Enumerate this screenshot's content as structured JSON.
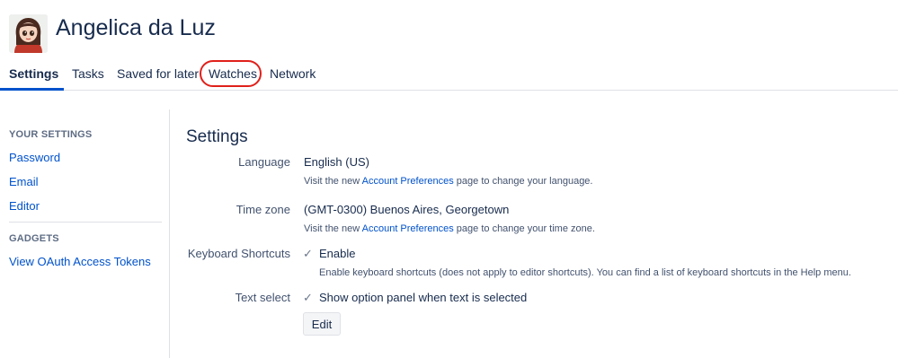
{
  "user": {
    "name": "Angelica da Luz"
  },
  "tabs": [
    {
      "label": "Settings"
    },
    {
      "label": "Tasks"
    },
    {
      "label": "Saved for later"
    },
    {
      "label": "Watches"
    },
    {
      "label": "Network"
    }
  ],
  "sidebar": {
    "your_settings_heading": "YOUR SETTINGS",
    "links": [
      "Password",
      "Email",
      "Editor"
    ],
    "gadgets_heading": "GADGETS",
    "gadget_links": [
      "View OAuth Access Tokens"
    ]
  },
  "settings": {
    "title": "Settings",
    "language": {
      "label": "Language",
      "value": "English (US)",
      "help_prefix": "Visit the new ",
      "help_link": "Account Preferences",
      "help_suffix": " page to change your language."
    },
    "timezone": {
      "label": "Time zone",
      "value": "(GMT-0300) Buenos Aires, Georgetown",
      "help_prefix": "Visit the new ",
      "help_link": "Account Preferences",
      "help_suffix": " page to change your time zone."
    },
    "keyboard_shortcuts": {
      "label": "Keyboard Shortcuts",
      "checkbox_label": "Enable",
      "checked": true,
      "help": "Enable keyboard shortcuts (does not apply to editor shortcuts). You can find a list of keyboard shortcuts in the Help menu."
    },
    "text_select": {
      "label": "Text select",
      "checkbox_label": "Show option panel when text is selected",
      "checked": true
    },
    "edit_button": "Edit"
  },
  "colors": {
    "link": "#0052cc",
    "highlight_ring": "#e0201b",
    "text": "#172b4d"
  }
}
